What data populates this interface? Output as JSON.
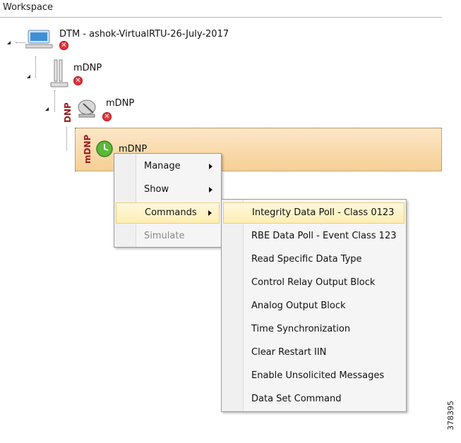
{
  "workspace": {
    "title": "Workspace"
  },
  "tree": {
    "root": {
      "label": "DTM - ashok-VirtualRTU-26-July-2017",
      "icon": "computer-icon"
    },
    "channel": {
      "label": "mDNP",
      "icon": "server-tower-icon"
    },
    "protocol": {
      "label": "mDNP",
      "tag": "DNP",
      "icon": "satellite-dish-icon"
    },
    "device": {
      "label": "mDNP",
      "tag": "mDNP",
      "icon": "green-status-icon"
    }
  },
  "context_menu": {
    "items": [
      {
        "label": "Manage",
        "has_submenu": true,
        "disabled": false
      },
      {
        "label": "Show",
        "has_submenu": true,
        "disabled": false
      },
      {
        "label": "Commands",
        "has_submenu": true,
        "disabled": false,
        "highlighted": true
      },
      {
        "label": "Simulate",
        "has_submenu": false,
        "disabled": true
      }
    ]
  },
  "commands_submenu": {
    "items": [
      {
        "label": "Integrity Data Poll - Class 0123",
        "highlighted": true
      },
      {
        "label": "RBE Data Poll - Event Class 123"
      },
      {
        "label": "Read Specific Data Type"
      },
      {
        "label": "Control Relay Output Block"
      },
      {
        "label": "Analog Output Block"
      },
      {
        "label": "Time Synchronization"
      },
      {
        "label": "Clear Restart IIN"
      },
      {
        "label": "Enable Unsolicited Messages"
      },
      {
        "label": "Data Set Command"
      }
    ]
  },
  "figure_id": "378395",
  "colors": {
    "error": "#e2333a",
    "selection": "#f6cf93",
    "tag": "#9b1b1f",
    "highlight": "#fdeeb5"
  }
}
